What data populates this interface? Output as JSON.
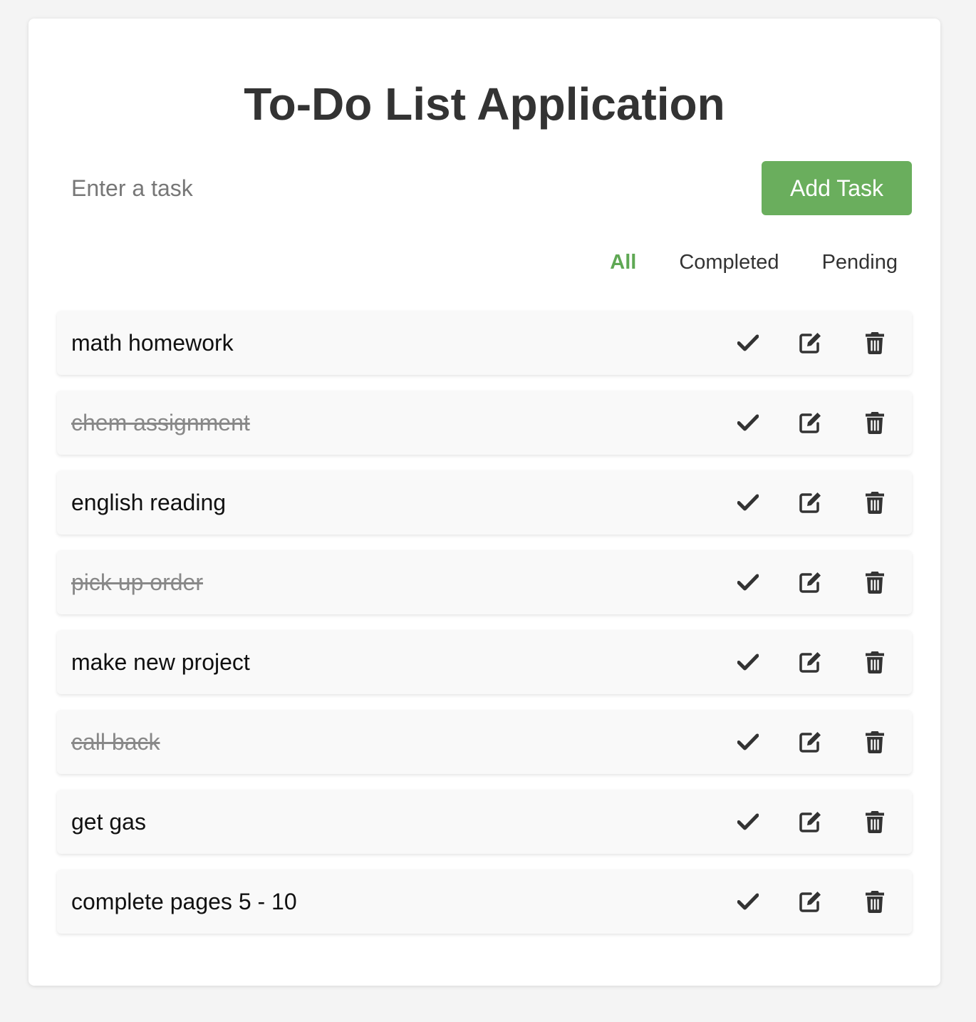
{
  "app": {
    "title": "To-Do List Application"
  },
  "input": {
    "placeholder": "Enter a task",
    "value": ""
  },
  "add_button": {
    "label": "Add Task",
    "color": "#6aae5d"
  },
  "filters": [
    {
      "label": "All",
      "active": true
    },
    {
      "label": "Completed",
      "active": false
    },
    {
      "label": "Pending",
      "active": false
    }
  ],
  "tasks": [
    {
      "text": "math homework",
      "completed": false
    },
    {
      "text": "chem assignment",
      "completed": true
    },
    {
      "text": "english reading",
      "completed": false
    },
    {
      "text": "pick up order",
      "completed": true
    },
    {
      "text": "make new project",
      "completed": false
    },
    {
      "text": "call back",
      "completed": true
    },
    {
      "text": "get gas",
      "completed": false
    },
    {
      "text": "complete pages 5 - 10",
      "completed": false
    }
  ],
  "task_actions": [
    {
      "name": "complete",
      "icon": "check-icon"
    },
    {
      "name": "edit",
      "icon": "edit-icon"
    },
    {
      "name": "delete",
      "icon": "trash-icon"
    }
  ],
  "colors": {
    "accent": "#5fa854",
    "icon": "#333333",
    "completed_text": "#888888"
  }
}
